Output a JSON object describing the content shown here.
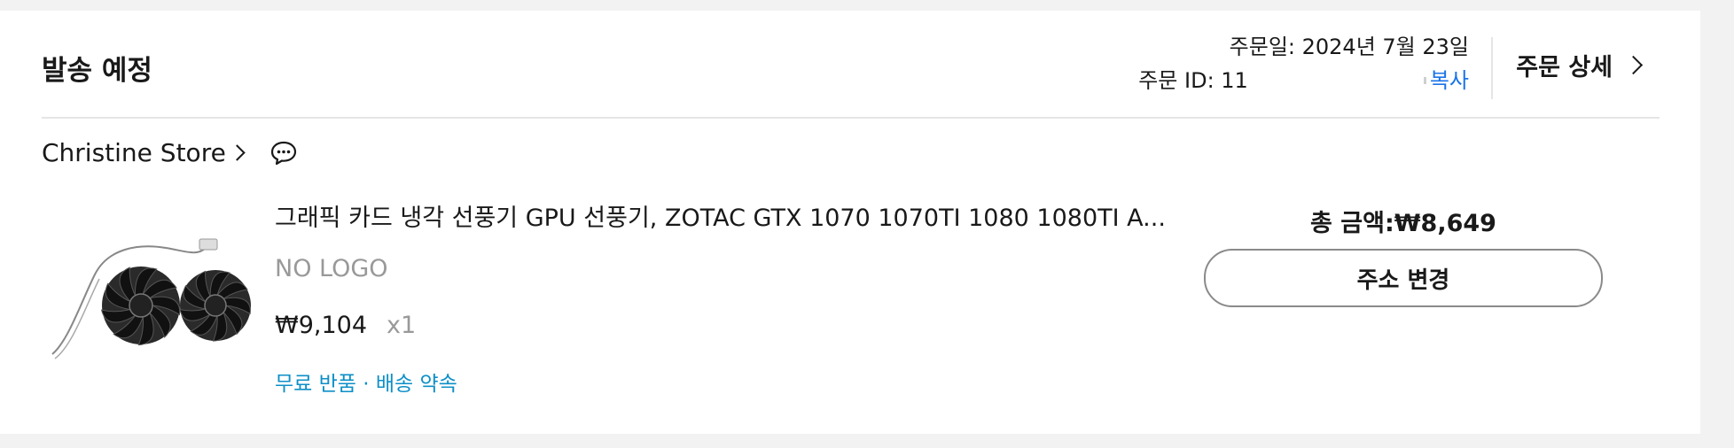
{
  "order": {
    "status": "발송 예정",
    "order_date": "주문일: 2024년 7월 23일",
    "order_id_label": "주문 ID: 11",
    "copy_label": "복사",
    "detail_label": "주문 상세"
  },
  "store": {
    "name": "Christine Store",
    "chat_icon": "chat-bubble-icon"
  },
  "item": {
    "title": "그래픽 카드 냉각 선풍기 GPU 선풍기, ZOTAC GTX 1070 1070TI 1080 1080TI A...",
    "variant": "NO LOGO",
    "price": "₩9,104",
    "quantity": "x1",
    "tags": "무료 반품 · 배송 약속",
    "image_icon": "gpu-fan-product-image"
  },
  "summary": {
    "total": "총 금액:₩8,649",
    "change_address_label": "주소 변경"
  },
  "colors": {
    "link_blue": "#1a73e8",
    "tag_blue": "#0d8fc7",
    "muted_gray": "#999999"
  }
}
